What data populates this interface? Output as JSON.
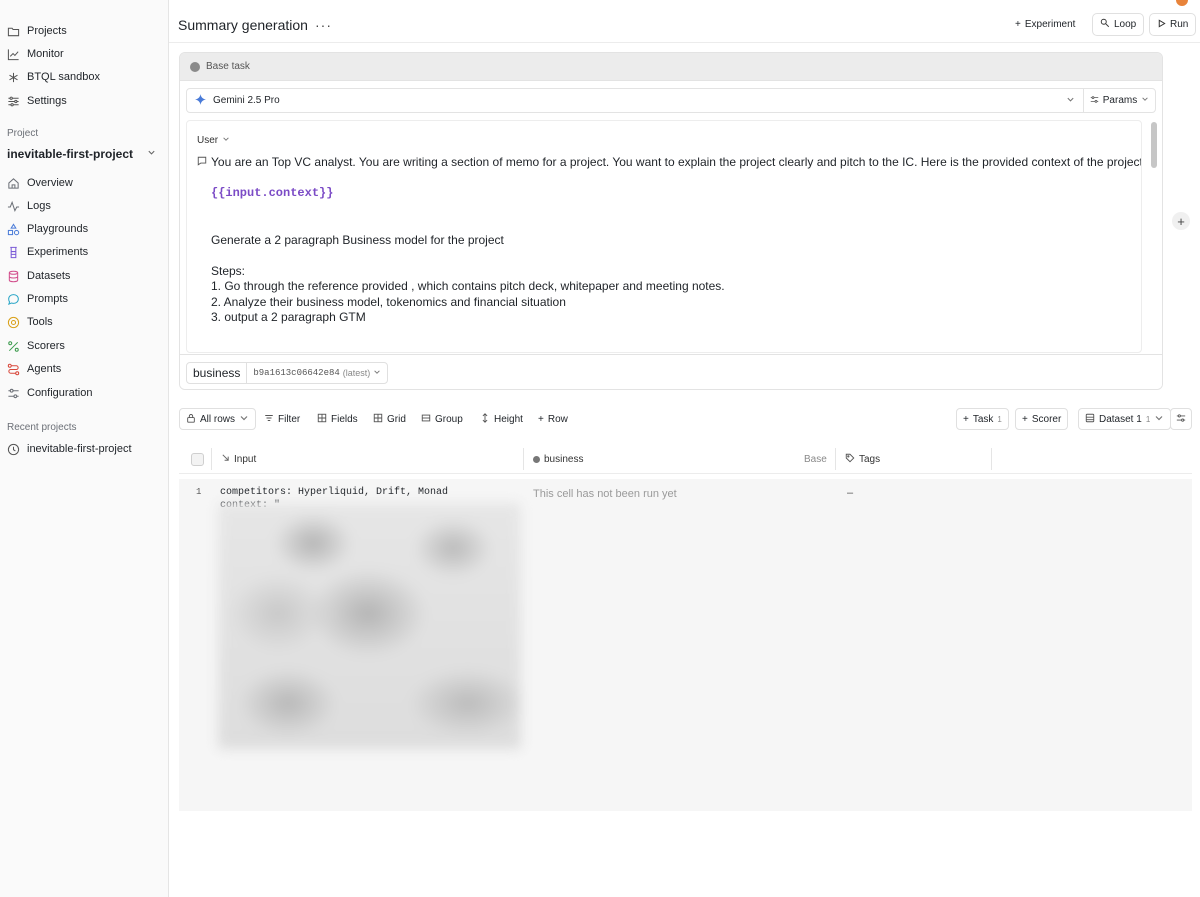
{
  "sidebar": {
    "top_items": [
      {
        "label": "Projects",
        "icon": "folder-icon"
      },
      {
        "label": "Monitor",
        "icon": "chart-icon"
      },
      {
        "label": "BTQL sandbox",
        "icon": "asterisk-icon"
      },
      {
        "label": "Settings",
        "icon": "sliders-icon"
      }
    ],
    "project_section_label": "Project",
    "project_name": "inevitable-first-project",
    "project_items": [
      {
        "label": "Overview",
        "icon": "home-icon",
        "color": "#6b6f76"
      },
      {
        "label": "Logs",
        "icon": "activity-icon",
        "color": "#6b6f76"
      },
      {
        "label": "Playgrounds",
        "icon": "shapes-icon",
        "color": "#4a7bd8"
      },
      {
        "label": "Experiments",
        "icon": "beaker-icon",
        "color": "#7a5ad6"
      },
      {
        "label": "Datasets",
        "icon": "database-icon",
        "color": "#d24e8c"
      },
      {
        "label": "Prompts",
        "icon": "message-icon",
        "color": "#2aa6c7"
      },
      {
        "label": "Tools",
        "icon": "bolt-circle-icon",
        "color": "#d9a018"
      },
      {
        "label": "Scorers",
        "icon": "percent-icon",
        "color": "#3a9a4c"
      },
      {
        "label": "Agents",
        "icon": "route-icon",
        "color": "#d8473b"
      },
      {
        "label": "Configuration",
        "icon": "sliders-icon",
        "color": "#6b6f76"
      }
    ],
    "recent_label": "Recent projects",
    "recent_items": [
      {
        "label": "inevitable-first-project",
        "icon": "clock-icon"
      }
    ]
  },
  "header": {
    "title": "Summary generation",
    "more": "···",
    "experiment_label": "Experiment",
    "loop_label": "Loop",
    "run_label": "Run"
  },
  "task": {
    "header_label": "Base task",
    "model": "Gemini 2.5 Pro",
    "params_label": "Params",
    "role": "User",
    "prompt_intro": "You are an Top VC analyst. You are writing a section of memo for a project. You want to explain the project clearly and pitch to the IC. Here is the provided context of the project.",
    "prompt_variable": "{{input.context}}",
    "prompt_lines": [
      "Generate a 2 paragraph Business model for the project",
      "Steps:",
      "1. Go through the reference provided , which contains pitch deck, whitepaper and meeting notes.",
      "2. Analyze their business model, tokenomics and financial situation",
      "3. output a 2 paragraph GTM"
    ],
    "dataset_name": "business",
    "dataset_version": "b9a1613c06642e84",
    "dataset_version_tag": "(latest)"
  },
  "toolbar": {
    "all_rows": "All rows",
    "filter": "Filter",
    "fields": "Fields",
    "grid": "Grid",
    "group": "Group",
    "height": "Height",
    "row": "Row",
    "task": "Task",
    "task_count": "1",
    "scorer": "Scorer",
    "dataset": "Dataset 1",
    "dataset_count": "1"
  },
  "table": {
    "columns": {
      "input": "Input",
      "business": "business",
      "base": "Base",
      "tags": "Tags"
    },
    "rows": [
      {
        "num": "1",
        "input": "competitors: Hyperliquid, Drift, Monad\ncontext: \"",
        "output_placeholder": "This cell has not been run yet",
        "tags": "–"
      }
    ]
  },
  "colors": {
    "accent_purple": "#7b4bc6",
    "avatar": "#e8833a"
  }
}
